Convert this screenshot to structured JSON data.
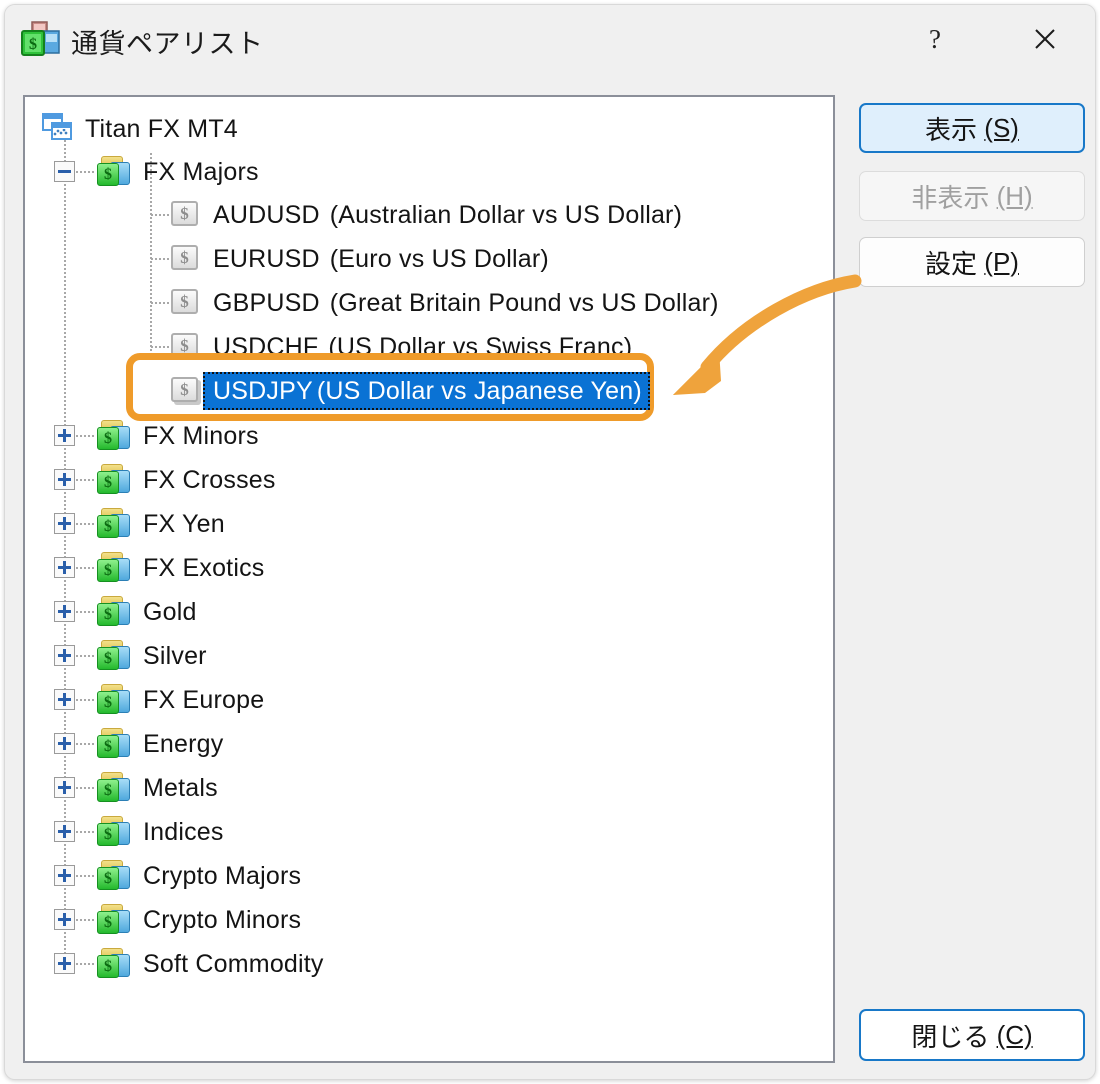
{
  "window": {
    "title": "通貨ペアリスト",
    "icon": "money-bag-icon",
    "help_label": "?",
    "close_label": "✕"
  },
  "tree": {
    "root": {
      "label": "Titan FX MT4",
      "icon": "chart-windows-icon"
    },
    "nodes": [
      {
        "label": "FX Majors",
        "icon": "folder-money-icon",
        "state": "expanded",
        "expander": "minus"
      },
      {
        "label": "FX Minors",
        "icon": "folder-money-icon",
        "state": "collapsed",
        "expander": "plus"
      },
      {
        "label": "FX Crosses",
        "icon": "folder-money-icon",
        "state": "collapsed",
        "expander": "plus"
      },
      {
        "label": "FX Yen",
        "icon": "folder-money-icon",
        "state": "collapsed",
        "expander": "plus"
      },
      {
        "label": "FX Exotics",
        "icon": "folder-money-icon",
        "state": "collapsed",
        "expander": "plus"
      },
      {
        "label": "Gold",
        "icon": "folder-money-icon",
        "state": "collapsed",
        "expander": "plus"
      },
      {
        "label": "Silver",
        "icon": "folder-money-icon",
        "state": "collapsed",
        "expander": "plus"
      },
      {
        "label": "FX Europe",
        "icon": "folder-money-icon",
        "state": "collapsed",
        "expander": "plus"
      },
      {
        "label": "Energy",
        "icon": "folder-money-icon",
        "state": "collapsed",
        "expander": "plus"
      },
      {
        "label": "Metals",
        "icon": "folder-money-icon",
        "state": "collapsed",
        "expander": "plus"
      },
      {
        "label": "Indices",
        "icon": "folder-money-icon",
        "state": "collapsed",
        "expander": "plus"
      },
      {
        "label": "Crypto Majors",
        "icon": "folder-money-icon",
        "state": "collapsed",
        "expander": "plus"
      },
      {
        "label": "Crypto Minors",
        "icon": "folder-money-icon",
        "state": "collapsed",
        "expander": "plus"
      },
      {
        "label": "Soft Commodity",
        "icon": "folder-money-icon",
        "state": "collapsed",
        "expander": "plus"
      }
    ],
    "pairs": [
      {
        "symbol": "AUDUSD",
        "description": "(Australian Dollar vs US Dollar)",
        "icon": "banknote-icon",
        "selected": false
      },
      {
        "symbol": "EURUSD",
        "description": "(Euro vs US Dollar)",
        "icon": "banknote-icon",
        "selected": false
      },
      {
        "symbol": "GBPUSD",
        "description": "(Great Britain Pound vs US Dollar)",
        "icon": "banknote-icon",
        "selected": false
      },
      {
        "symbol": "USDCHF",
        "description": "(US Dollar vs Swiss Franc)",
        "icon": "banknote-icon",
        "selected": false
      },
      {
        "symbol": "USDJPY",
        "description": "(US Dollar vs Japanese Yen)",
        "icon": "banknote-icon",
        "selected": true
      }
    ]
  },
  "buttons": {
    "show": {
      "text": "表示",
      "accel": "(S)",
      "state": "default"
    },
    "hide": {
      "text": "非表示",
      "accel": "(H)",
      "state": "disabled"
    },
    "settings": {
      "text": "設定",
      "accel": "(P)",
      "state": "normal"
    },
    "close": {
      "text": "閉じる",
      "accel": "(C)",
      "state": "outline"
    }
  },
  "annotation": {
    "shape": "rounded-rectangle-highlight",
    "target": "USDJPY  (US Dollar vs Japanese Yen)",
    "arrow": "curved-arrow-pointing-down-left",
    "color": "#ef9b2a"
  },
  "colors": {
    "accent_orange": "#ef9b2a",
    "selection_blue": "#0a72d4",
    "dialog_background": "#f0f0f0",
    "panel_background": "#ffffff",
    "panel_border": "#8b8f99",
    "button_blue": "#1878c8"
  }
}
